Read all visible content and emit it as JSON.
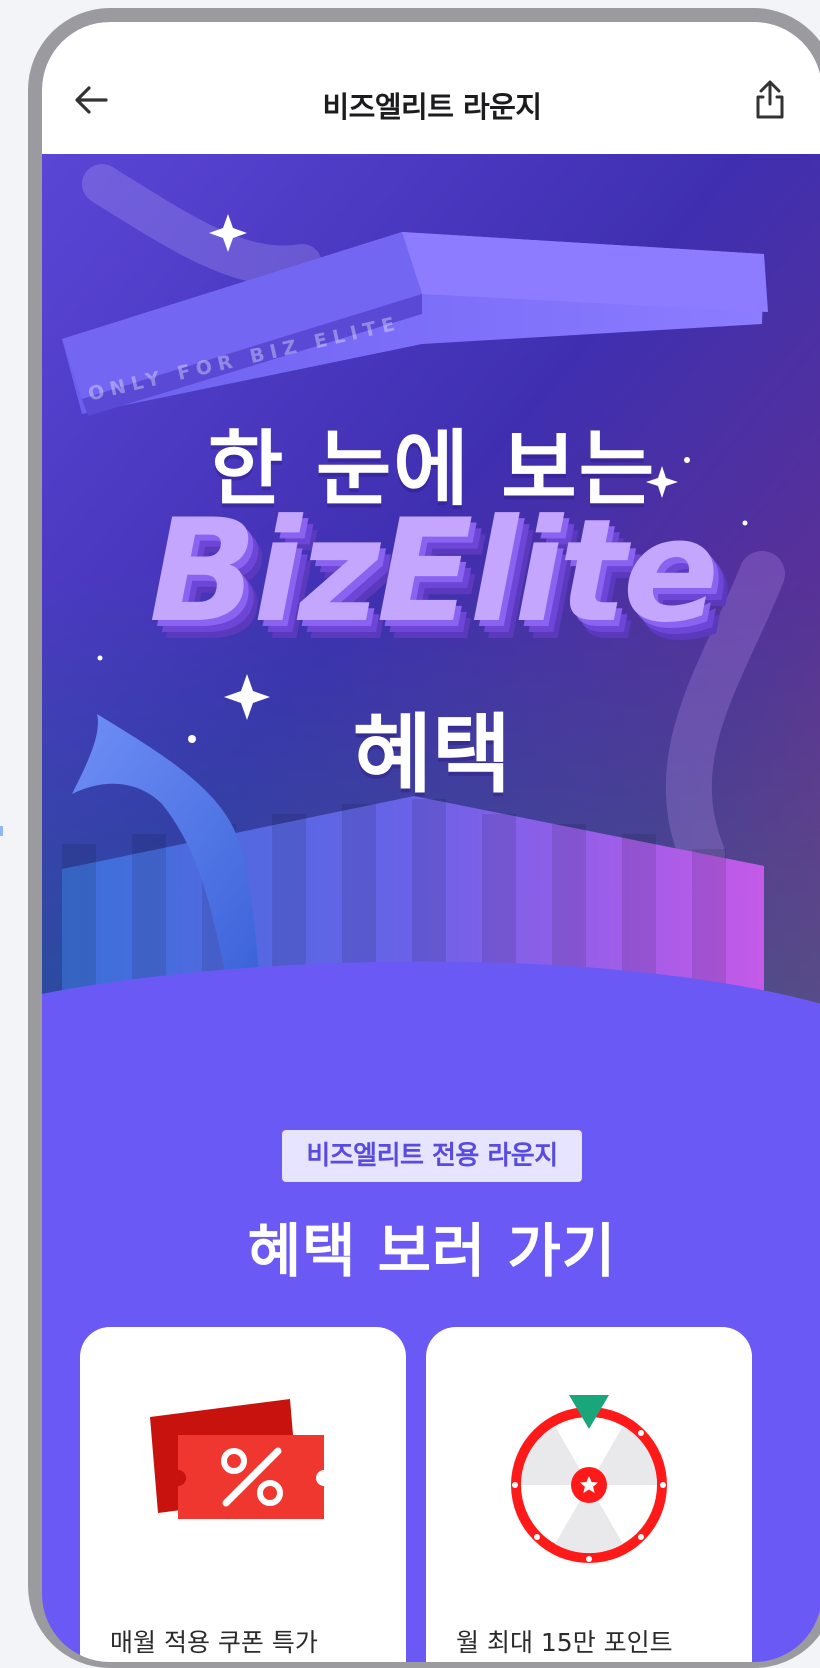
{
  "header": {
    "title": "비즈엘리트 라운지",
    "back_icon": "arrow-left-icon",
    "share_icon": "share-icon"
  },
  "hero": {
    "ribbon_text": "ONLY FOR BIZ ELITE",
    "line1": "한 눈에 보는",
    "brand": "BizElite",
    "line2": "혜택"
  },
  "section": {
    "badge": "비즈엘리트 전용 라운지",
    "title": "혜택 보러 가기"
  },
  "cards": [
    {
      "icon": "coupon-percent-icon",
      "label": "매월 적용 쿠폰 특가"
    },
    {
      "icon": "roulette-wheel-icon",
      "label": "월 최대 15만 포인트"
    }
  ],
  "colors": {
    "accent": "#6b59f6",
    "badge_bg": "#e7e4ff",
    "coupon_red": "#f0372f",
    "roulette_red": "#ff1a1a",
    "pointer_green": "#19a67b"
  }
}
